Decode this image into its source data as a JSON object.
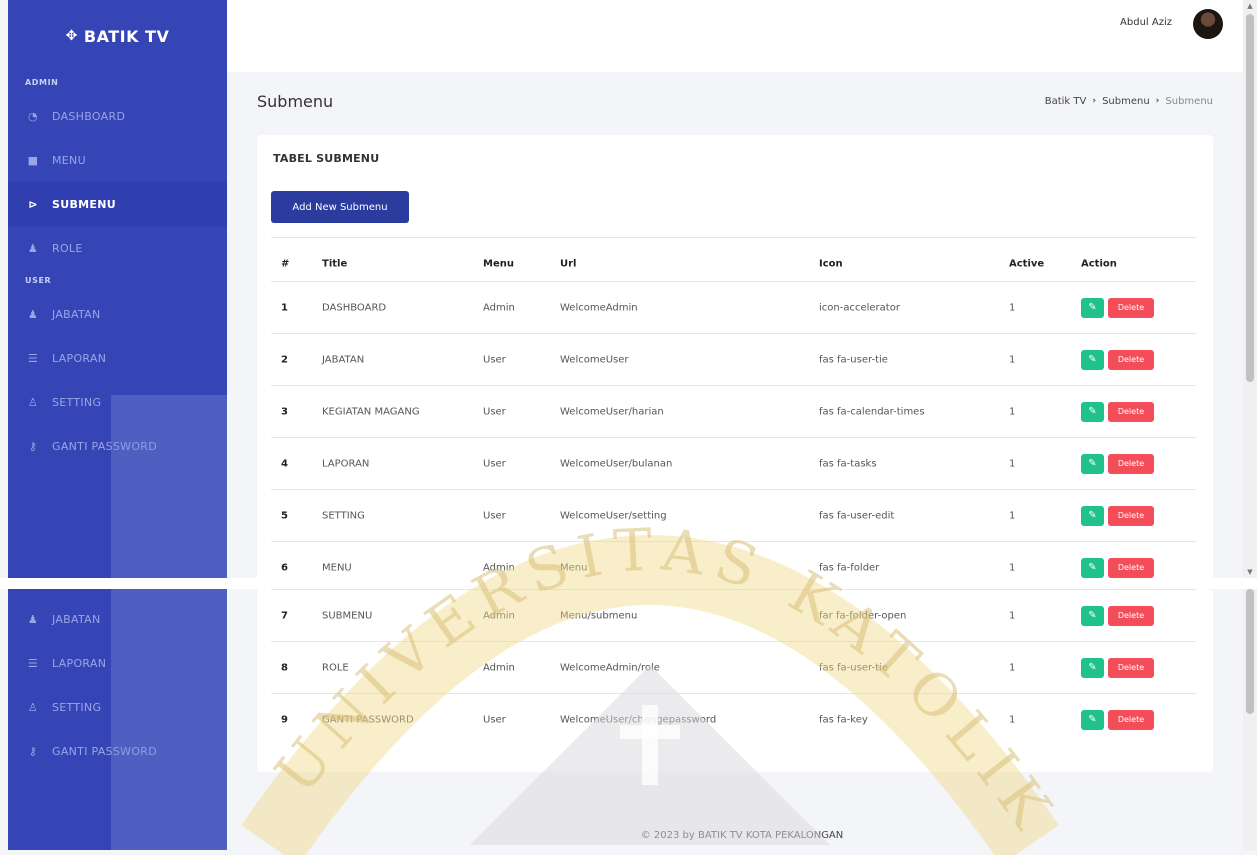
{
  "brand": {
    "name": "BATIK TV",
    "icon": "crosshair-icon"
  },
  "sidebar": {
    "section_admin": "ADMIN",
    "section_user": "USER",
    "admin_items": [
      {
        "label": "DASHBOARD",
        "icon": "dashboard-icon"
      },
      {
        "label": "MENU",
        "icon": "folder-icon"
      },
      {
        "label": "SUBMENU",
        "icon": "folder-open-icon",
        "active": true
      },
      {
        "label": "ROLE",
        "icon": "user-tie-icon"
      }
    ],
    "user_items": [
      {
        "label": "JABATAN",
        "icon": "user-tie-icon"
      },
      {
        "label": "LAPORAN",
        "icon": "tasks-icon"
      },
      {
        "label": "SETTING",
        "icon": "user-edit-icon"
      },
      {
        "label": "GANTI PASSWORD",
        "icon": "key-icon"
      }
    ]
  },
  "topbar": {
    "user_name": "Abdul Aziz"
  },
  "page": {
    "title": "Submenu",
    "breadcrumb": [
      "Batik TV",
      "Submenu",
      "Submenu"
    ]
  },
  "card": {
    "title": "TABEL SUBMENU",
    "add_button": "Add New Submenu"
  },
  "table": {
    "headers": [
      "#",
      "Title",
      "Menu",
      "Url",
      "Icon",
      "Active",
      "Action"
    ],
    "rows": [
      {
        "no": "1",
        "title": "DASHBOARD",
        "menu": "Admin",
        "url": "WelcomeAdmin",
        "icon": "icon-accelerator",
        "active": "1"
      },
      {
        "no": "2",
        "title": "JABATAN",
        "menu": "User",
        "url": "WelcomeUser",
        "icon": "fas fa-user-tie",
        "active": "1"
      },
      {
        "no": "3",
        "title": "KEGIATAN MAGANG",
        "menu": "User",
        "url": "WelcomeUser/harian",
        "icon": "fas fa-calendar-times",
        "active": "1"
      },
      {
        "no": "4",
        "title": "LAPORAN",
        "menu": "User",
        "url": "WelcomeUser/bulanan",
        "icon": "fas fa-tasks",
        "active": "1"
      },
      {
        "no": "5",
        "title": "SETTING",
        "menu": "User",
        "url": "WelcomeUser/setting",
        "icon": "fas fa-user-edit",
        "active": "1"
      },
      {
        "no": "6",
        "title": "MENU",
        "menu": "Admin",
        "url": "Menu",
        "icon": "fas fa-folder",
        "active": "1"
      },
      {
        "no": "7",
        "title": "SUBMENU",
        "menu": "Admin",
        "url": "Menu/submenu",
        "icon": "far fa-folder-open",
        "active": "1"
      },
      {
        "no": "8",
        "title": "ROLE",
        "menu": "Admin",
        "url": "WelcomeAdmin/role",
        "icon": "fas fa-user-tie",
        "active": "1"
      },
      {
        "no": "9",
        "title": "GANTI PASSWORD",
        "menu": "User",
        "url": "WelcomeUser/changepassword",
        "icon": "fas fa-key",
        "active": "1"
      }
    ],
    "delete_label": "Delete",
    "edit_icon": "edit-icon"
  },
  "footer": {
    "text": "© 2023 by BATIK TV KOTA PEKALONGAN"
  },
  "watermark": {
    "text": "UNIVERSITAS KATOLIK"
  },
  "colors": {
    "sidebar": "#3545b5",
    "primary_button": "#2c3b9e",
    "edit_button": "#1fc28a",
    "delete_button": "#f34d5a"
  }
}
